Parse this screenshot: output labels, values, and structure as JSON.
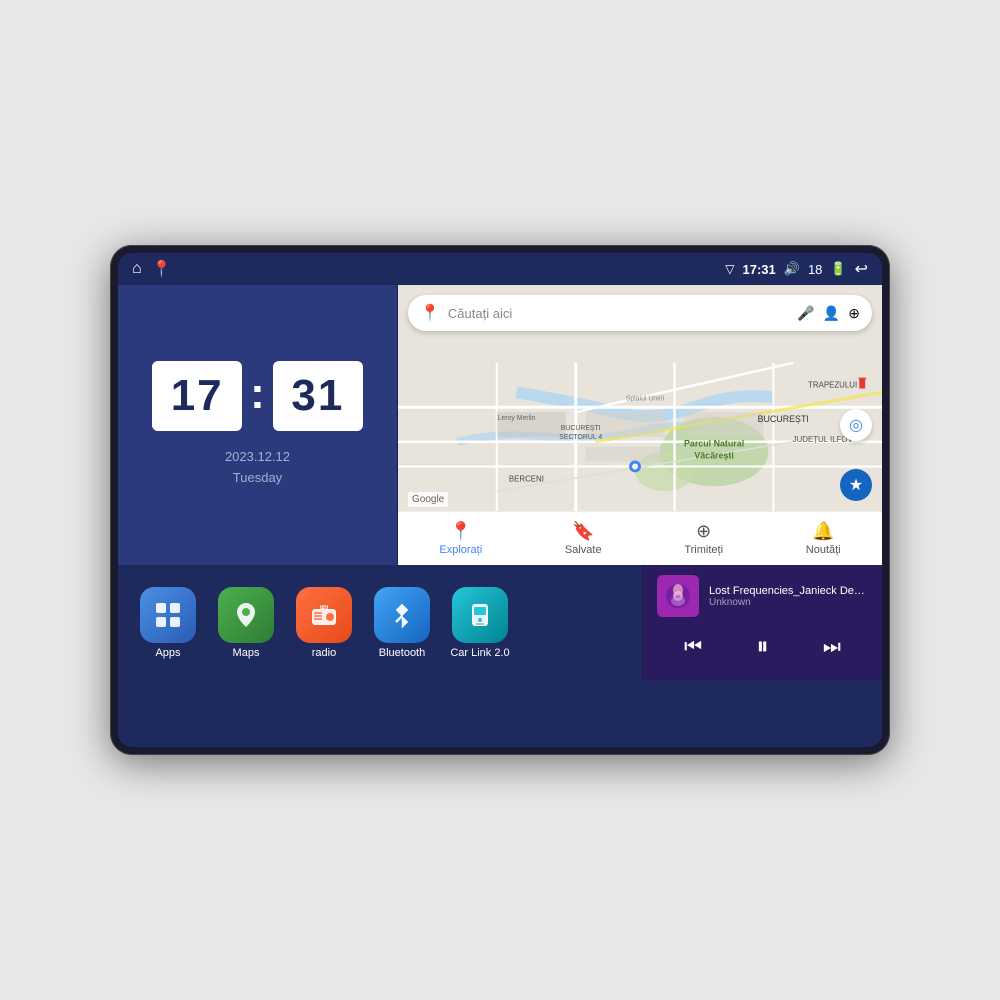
{
  "device": {
    "status_bar": {
      "left_icons": [
        "home",
        "maps"
      ],
      "time": "17:31",
      "volume_level": "18",
      "battery": "",
      "back": "↩"
    },
    "clock": {
      "hours": "17",
      "minutes": "31",
      "date": "2023.12.12",
      "day": "Tuesday"
    },
    "map": {
      "search_placeholder": "Căutați aici",
      "nav_items": [
        {
          "label": "Explorați",
          "active": true
        },
        {
          "label": "Salvate",
          "active": false
        },
        {
          "label": "Trimiteți",
          "active": false
        },
        {
          "label": "Noutăți",
          "active": false
        }
      ],
      "places": [
        "Parcul Natural Văcărești",
        "BUCUREȘTI",
        "JUDEȚUL ILFOV",
        "TRAPEZULUI",
        "BERCENI",
        "Leroy Merlin",
        "BUCUREȘTI SECTORUL 4",
        "Splaiui Unirii"
      ]
    },
    "apps": [
      {
        "id": "apps",
        "label": "Apps",
        "icon": "⊞",
        "color": "icon-apps"
      },
      {
        "id": "maps",
        "label": "Maps",
        "icon": "📍",
        "color": "icon-maps"
      },
      {
        "id": "radio",
        "label": "radio",
        "icon": "📻",
        "color": "icon-radio"
      },
      {
        "id": "bluetooth",
        "label": "Bluetooth",
        "icon": "🔵",
        "color": "icon-bluetooth"
      },
      {
        "id": "carlink",
        "label": "Car Link 2.0",
        "icon": "📱",
        "color": "icon-carlink"
      }
    ],
    "music": {
      "title": "Lost Frequencies_Janieck Devy-...",
      "artist": "Unknown",
      "thumbnail_emoji": "🎵"
    }
  }
}
